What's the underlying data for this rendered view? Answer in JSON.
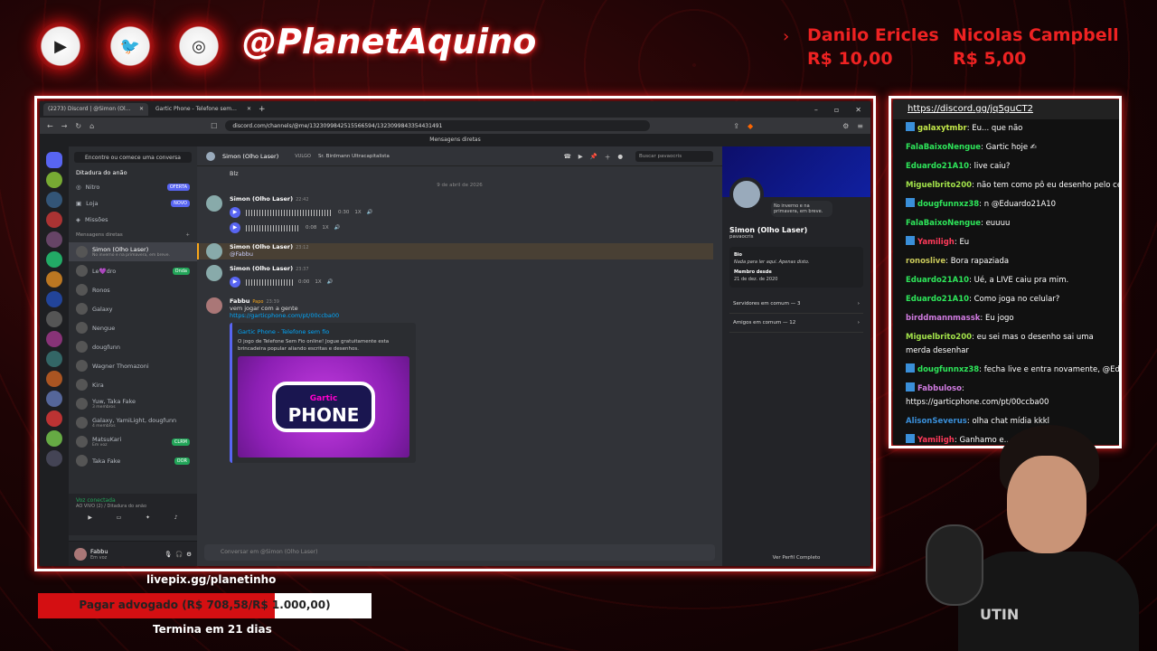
{
  "overlay": {
    "handle": "@PlanetAquino",
    "socials": [
      "youtube-icon",
      "twitter-icon",
      "instagram-icon"
    ],
    "donors": [
      {
        "name": "Danilo Ericles",
        "amount": "R$ 10,00"
      },
      {
        "name": "Nicolas Campbell",
        "amount": "R$ 5,00"
      }
    ],
    "livepix": "livepix.gg/planetinho",
    "goal_text": "Pagar advogado (R$ 708,58/R$ 1.000,00)",
    "goal_progress": 0.71,
    "ends": "Termina em 21 dias",
    "webcam_shirt": "UTIN"
  },
  "browser": {
    "tabs": [
      {
        "label": "(2273) Discord | @Simon (Ol...",
        "active": true
      },
      {
        "label": "Gartic Phone - Telefone sem...",
        "active": false
      }
    ],
    "url": "discord.com/channels/@me/1323099842515566594/1323099843354431491",
    "window_title": "Mensagens diretas"
  },
  "discord": {
    "find_button": "Encontre ou comece uma conversa",
    "server_popup": "Ditadura do anão",
    "nav": [
      {
        "label": "Nitro",
        "badge": "OFERTA"
      },
      {
        "label": "Loja",
        "badge": "NOVO"
      },
      {
        "label": "Missões",
        "badge": ""
      }
    ],
    "dm_header": "Mensagens diretas",
    "dms": [
      {
        "name": "Simon (Olho Laser)",
        "sub": "No inverno e na primavera, em breve.",
        "selected": true,
        "badge": ""
      },
      {
        "name": "Le💜dro",
        "sub": "",
        "selected": false,
        "badge": "Onda"
      },
      {
        "name": "Ronos",
        "sub": "",
        "selected": false,
        "badge": ""
      },
      {
        "name": "Galaxy",
        "sub": "",
        "selected": false,
        "badge": ""
      },
      {
        "name": "Nengue",
        "sub": "",
        "selected": false,
        "badge": ""
      },
      {
        "name": "dougfunn",
        "sub": "",
        "selected": false,
        "badge": ""
      },
      {
        "name": "Wagner Thomazoni",
        "sub": "",
        "selected": false,
        "badge": ""
      },
      {
        "name": "Kira",
        "sub": "",
        "selected": false,
        "badge": ""
      },
      {
        "name": "Yuw, Taka Fake",
        "sub": "3 membros",
        "selected": false,
        "badge": ""
      },
      {
        "name": "Galaxy, YamiLight, dougfunn",
        "sub": "4 membros",
        "selected": false,
        "badge": ""
      },
      {
        "name": "MatsuKari",
        "sub": "Em voz",
        "selected": false,
        "badge": "CLRM"
      },
      {
        "name": "Taka Fake",
        "sub": "",
        "selected": false,
        "badge": "OOR"
      }
    ],
    "voice": {
      "status": "Voz conectada",
      "channel": "AO VIVO (2) / Ditadura do anão"
    },
    "user": {
      "name": "Fabbu",
      "status": "Em voz"
    },
    "chat_header": {
      "name": "Simon (Olho Laser)",
      "tag": "VULGO",
      "alias": "Sr. Birdmann Ultracapitalista",
      "search": "Buscar pavaocris"
    },
    "messages": {
      "first_text": "Blz",
      "date_sep": "9 de abril de 2026",
      "m1_name": "Simon (Olho Laser)",
      "m1_time": "22:42",
      "a1_dur": "0:30",
      "a2_dur": "0:08",
      "m2_name": "Simon (Olho Laser)",
      "m2_time": "23:12",
      "m2_text": "@Fabbu",
      "m3_name": "Simon (Olho Laser)",
      "m3_time": "23:37",
      "a3_dur": "0:00",
      "speed": "1X",
      "m4_name": "Fabbu",
      "m4_role": "Papo",
      "m4_time": "23:39",
      "m4_text": "vem jogar com a gente",
      "m4_link": "https://garticphone.com/pt/00ccba00",
      "embed_title": "Gartic Phone - Telefone sem fio",
      "embed_desc": "O jogo de Telefone Sem Fio online! Jogue gratuitamente esta brincadeira popular aliando escritas e desenhos.",
      "embed_logo_top": "Gartic",
      "embed_logo_bottom": "PHONE"
    },
    "composer_placeholder": "Conversar em @Simon (Olho Laser)",
    "profile": {
      "name": "Simon (Olho Laser)",
      "user": "pavaocris",
      "bubble": "No inverno e na primavera, em breve.",
      "bio_label": "Bio",
      "bio": "Nada para ler aqui. Apenas disto.",
      "member_label": "Membro desde",
      "member_since": "21 de dez. de 2020",
      "servers": "Servidores em comum — 3",
      "friends": "Amigos em comum — 12",
      "full": "Ver Perfil Completo"
    }
  },
  "stream_chat": {
    "link": "https://discord.gg/jq5guCT2",
    "lines": [
      {
        "name": "galaxytmbr",
        "color": "#c3e84a",
        "text": "Eu... que não",
        "icon": true
      },
      {
        "name": "FalaBaixoNengue",
        "color": "#2ee65a",
        "text": "Gartic hoje ✍",
        "icon": false
      },
      {
        "name": "Eduardo21A10",
        "color": "#2ee65a",
        "text": "live caiu?",
        "icon": false
      },
      {
        "name": "Miguelbrito200",
        "color": "#a2e24a",
        "text": "não tem como pô eu desenho pelo ce",
        "icon": false
      },
      {
        "name": "dougfunnxz38",
        "color": "#2ee65a",
        "text": "n @Eduardo21A10",
        "icon": true
      },
      {
        "name": "FalaBaixoNengue",
        "color": "#2ee65a",
        "text": "euuuu",
        "icon": false
      },
      {
        "name": "Yamiligh",
        "color": "#ff3a5a",
        "text": "Eu",
        "icon": true
      },
      {
        "name": "ronoslive",
        "color": "#c9c95a",
        "text": "Bora rapaziada",
        "icon": false
      },
      {
        "name": "Eduardo21A10",
        "color": "#2ee65a",
        "text": "Ué, a LIVE caiu pra mim.",
        "icon": false
      },
      {
        "name": "Eduardo21A10",
        "color": "#2ee65a",
        "text": "Como joga no celular?",
        "icon": false
      },
      {
        "name": "birddmannmassk",
        "color": "#d07be0",
        "text": "Eu jogo",
        "icon": false
      },
      {
        "name": "Miguelbrito200",
        "color": "#a2e24a",
        "text": "eu sei mas o desenho sai uma merda desenhar",
        "icon": false
      },
      {
        "name": "dougfunnxz38",
        "color": "#2ee65a",
        "text": "fecha live e entra novamente, @Ed",
        "icon": true
      },
      {
        "name": "Fabbuloso",
        "color": "#d07be0",
        "text": "https://garticphone.com/pt/00ccba00",
        "icon": true
      },
      {
        "name": "AlisonSeverus",
        "color": "#3a8fd9",
        "text": "olha chat mídia kkkl",
        "icon": false
      },
      {
        "name": "Yamiligh",
        "color": "#ff3a5a",
        "text": "Ganhamo e... chupa mamats",
        "icon": true
      }
    ]
  }
}
